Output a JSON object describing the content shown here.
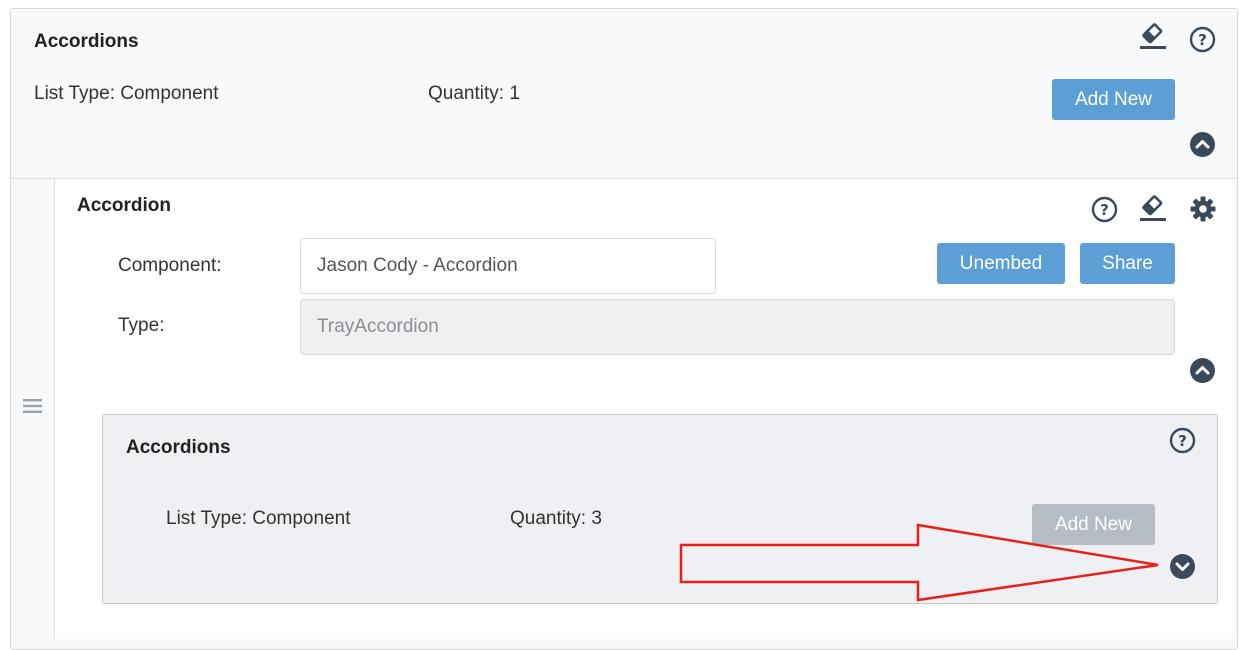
{
  "colors": {
    "accent_blue": "#5b9fd6",
    "disabled_gray": "#b5bcc4",
    "icon_dark": "#3b4a5a",
    "arrow_red": "#e8201c"
  },
  "top_list": {
    "title": "Accordions",
    "list_type": "List Type: Component",
    "quantity": "Quantity: 1",
    "add_new_label": "Add New",
    "icons": [
      "eraser-icon",
      "help-icon",
      "collapse-chevron-up-icon"
    ]
  },
  "accordion_item": {
    "title": "Accordion",
    "component_label": "Component:",
    "component_value": "Jason Cody - Accordion",
    "type_label": "Type:",
    "type_value": "TrayAccordion",
    "unembed_label": "Unembed",
    "share_label": "Share",
    "icons": [
      "help-icon",
      "eraser-icon",
      "gear-icon",
      "collapse-chevron-up-icon",
      "drag-handle-icon"
    ]
  },
  "nested_list": {
    "title": "Accordions",
    "list_type": "List Type: Component",
    "quantity": "Quantity: 3",
    "add_new_label": "Add New",
    "add_new_disabled": true,
    "icons": [
      "help-icon",
      "expand-chevron-down-icon"
    ]
  },
  "annotation": {
    "type": "arrow",
    "points_to": "expand-chevron-down-icon"
  }
}
